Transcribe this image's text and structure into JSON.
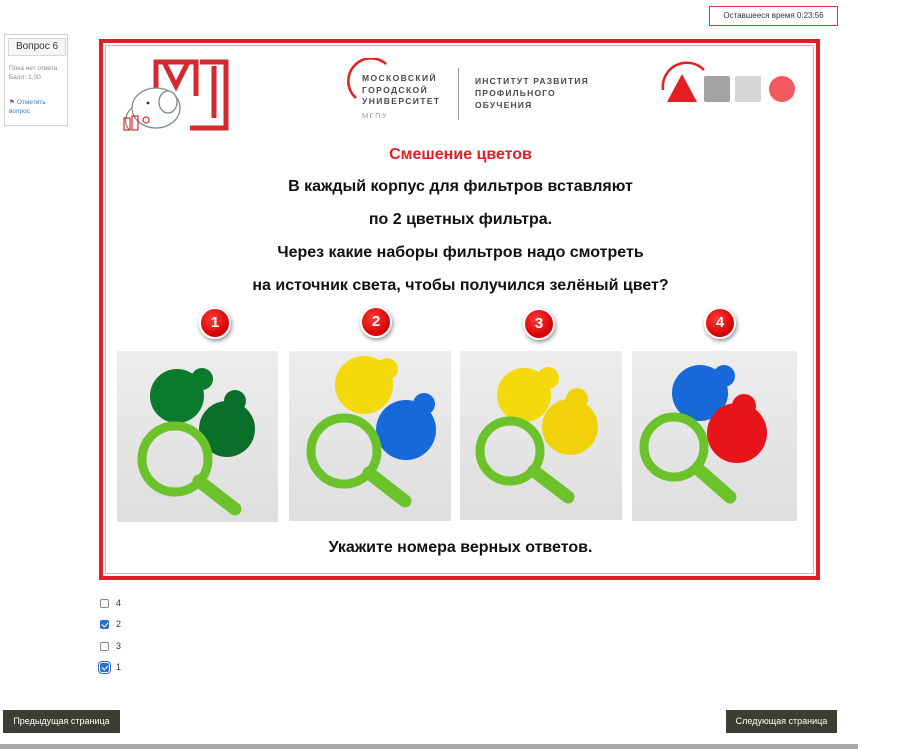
{
  "timer": {
    "text": "Оставшееся время 0:23:56"
  },
  "question_info": {
    "number": "Вопрос 6",
    "status": "Пока нет ответа",
    "grade": "Балл: 1,00",
    "flag_label": "Отметить вопрос"
  },
  "header": {
    "mgpu_lines": [
      "МОСКОВСКИЙ",
      "ГОРОДСКОЙ",
      "УНИВЕРСИТЕТ"
    ],
    "mgpu_abbr": "МГПУ",
    "institute_lines": [
      "ИНСТИТУТ РАЗВИТИЯ",
      "ПРОФИЛЬНОГО",
      "ОБУЧЕНИЯ"
    ]
  },
  "task": {
    "title": "Смешение цветов",
    "lines": [
      "В каждый корпус для фильтров вставляют",
      "по 2 цветных фильтра.",
      "Через какие наборы фильтров надо смотреть",
      "на источник света, чтобы получился зелёный цвет?"
    ],
    "footer": "Укажите номера верных ответов."
  },
  "pictures": [
    {
      "number": "1",
      "filters": [
        "green",
        "green"
      ]
    },
    {
      "number": "2",
      "filters": [
        "yellow",
        "blue"
      ]
    },
    {
      "number": "3",
      "filters": [
        "yellow",
        "yellow"
      ]
    },
    {
      "number": "4",
      "filters": [
        "blue",
        "red"
      ]
    }
  ],
  "colors": {
    "accent_red": "#e31e24",
    "green": "#0c7a2c",
    "yellow": "#f4d90c",
    "blue": "#1769d9",
    "red": "#e8141b",
    "magnifier": "#6cc22a",
    "checkbox_blue": "#2f73c7"
  },
  "answers": [
    {
      "label": "4",
      "checked": false,
      "focused": false
    },
    {
      "label": "2",
      "checked": true,
      "focused": false
    },
    {
      "label": "3",
      "checked": false,
      "focused": false
    },
    {
      "label": "1",
      "checked": true,
      "focused": true
    }
  ],
  "nav": {
    "prev": "Предыдущая страница",
    "next": "Следующая страница"
  }
}
